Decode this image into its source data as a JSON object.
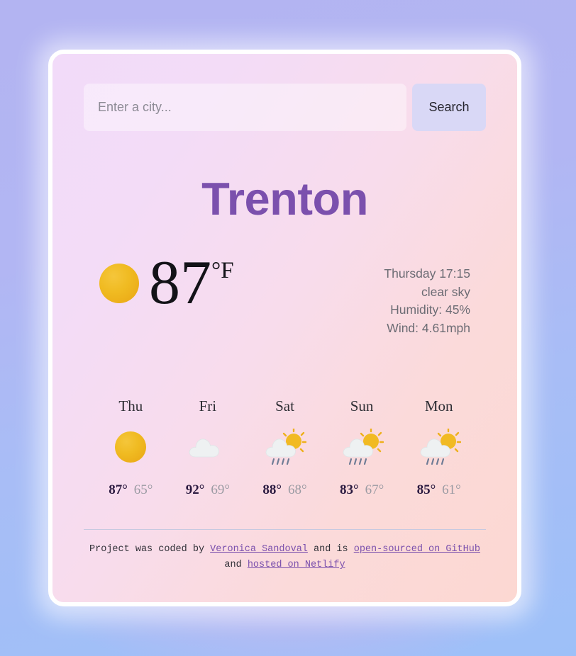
{
  "theme": {
    "page_background": "#aeb3f3",
    "card_gradient_start": "#f2dbf9",
    "card_gradient_end": "#fcd8d2",
    "accent_purple": "#7b50ad",
    "button_background": "#d9d8f6",
    "sun_yellow": "#f0bb22",
    "muted_text": "#6c6c74"
  },
  "search": {
    "placeholder": "Enter a city...",
    "value": "",
    "button_label": "Search"
  },
  "city": {
    "name": "Trenton"
  },
  "current": {
    "icon": "sun-icon",
    "temperature": "87",
    "unit": "°F",
    "day_time": "Thursday 17:15",
    "description": "clear sky",
    "humidity": "Humidity: 45%",
    "wind": "Wind: 4.61mph"
  },
  "forecast": [
    {
      "day": "Thu",
      "icon": "sun-icon",
      "high": "87°",
      "low": "65°"
    },
    {
      "day": "Fri",
      "icon": "cloud-icon",
      "high": "92°",
      "low": "69°"
    },
    {
      "day": "Sat",
      "icon": "sun-rain-cloud-icon",
      "high": "88°",
      "low": "68°"
    },
    {
      "day": "Sun",
      "icon": "sun-rain-cloud-icon",
      "high": "83°",
      "low": "67°"
    },
    {
      "day": "Mon",
      "icon": "sun-rain-cloud-icon",
      "high": "85°",
      "low": "61°"
    }
  ],
  "footer": {
    "text_1": "Project was coded by ",
    "link_1": "Veronica Sandoval",
    "text_2": " and is ",
    "link_2": "open-sourced on GitHub",
    "text_3": " and ",
    "link_3": "hosted on Netlify"
  }
}
